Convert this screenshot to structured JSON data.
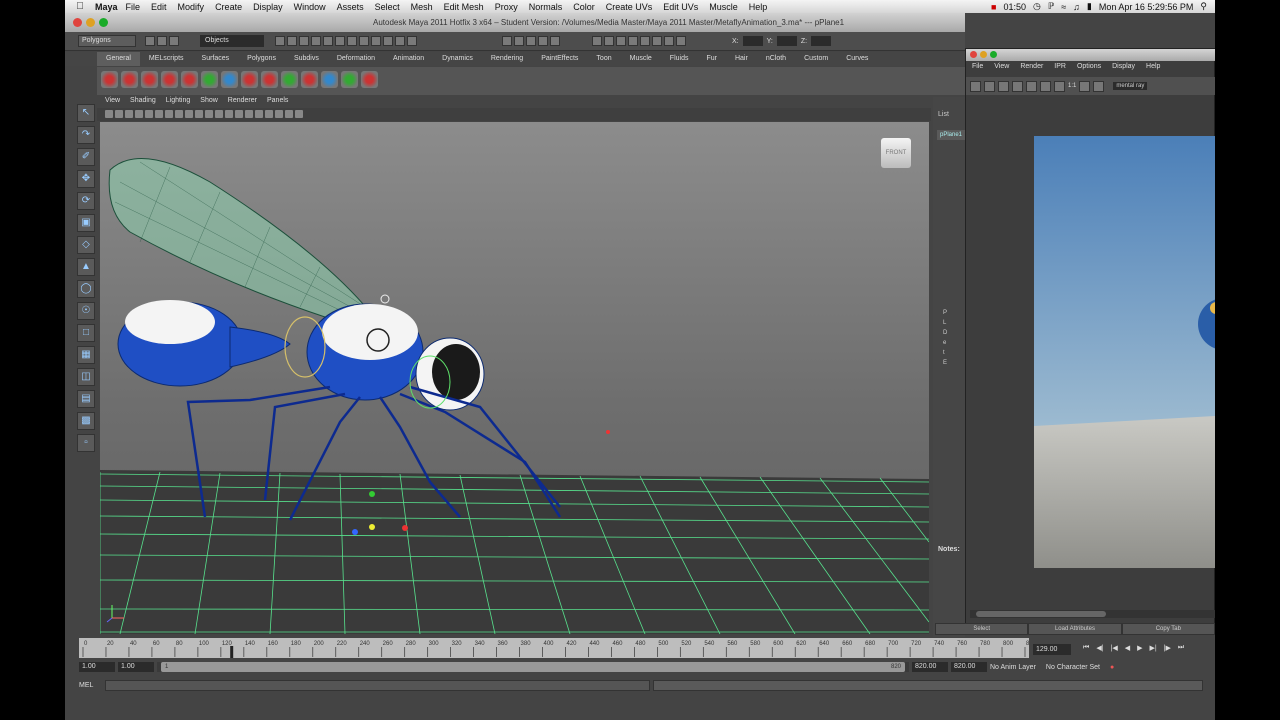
{
  "menubar": {
    "app_name": "Maya",
    "items": [
      "File",
      "Edit",
      "Modify",
      "Create",
      "Display",
      "Window",
      "Assets",
      "Select",
      "Mesh",
      "Edit Mesh",
      "Proxy",
      "Normals",
      "Color",
      "Create UVs",
      "Edit UVs",
      "Muscle",
      "Help"
    ],
    "clock": "01:50",
    "datetime": "Mon Apr 16  5:29:56 PM"
  },
  "window": {
    "title": "Autodesk Maya 2011 Hotfix 3 x64 – Student Version: /Volumes/Media Master/Maya 2011 Master/MetaflyAnimation_3.ma*  ---  pPlane1"
  },
  "status_line": {
    "mode": "Polygons",
    "selection_field": "Objects",
    "x_label": "X:",
    "y_label": "Y:",
    "z_label": "Z:"
  },
  "shelf": {
    "tabs": [
      "General",
      "MELscripts",
      "Surfaces",
      "Polygons",
      "Subdivs",
      "Deformation",
      "Animation",
      "Dynamics",
      "Rendering",
      "PaintEffects",
      "Toon",
      "Muscle",
      "Fluids",
      "Fur",
      "Hair",
      "nCloth",
      "Custom",
      "Curves"
    ],
    "active_tab": "General"
  },
  "panel": {
    "menus": [
      "View",
      "Shading",
      "Lighting",
      "Show",
      "Renderer",
      "Panels"
    ],
    "view_cube_label": "FRONT"
  },
  "channel_box": {
    "tab": "List",
    "selected_object": "pPlane1",
    "rows": [
      "P",
      "L",
      "D",
      "e",
      "t",
      "E"
    ],
    "notes_label": "Notes:"
  },
  "render_view": {
    "menus": [
      "File",
      "View",
      "Render",
      "IPR",
      "Options",
      "Display",
      "Help"
    ],
    "ratio_label": "1:1",
    "renderer": "mental ray"
  },
  "attribute_buttons": [
    "Select",
    "Load Attributes",
    "Copy Tab"
  ],
  "time_slider": {
    "ticks": [
      "0",
      "20",
      "40",
      "60",
      "80",
      "100",
      "120",
      "140",
      "160",
      "180",
      "200",
      "220",
      "240",
      "260",
      "280",
      "300",
      "320",
      "340",
      "360",
      "380",
      "400",
      "420",
      "440",
      "460",
      "480",
      "500",
      "520",
      "540",
      "560",
      "580",
      "600",
      "620",
      "640",
      "660",
      "680",
      "700",
      "720",
      "740",
      "760",
      "780",
      "800",
      "820"
    ],
    "current_frame": "129.00",
    "playhead_frame": 129
  },
  "range_slider": {
    "start_time": "1.00",
    "playback_start": "1.00",
    "slider_start": "1",
    "slider_end": "820",
    "playback_end": "820.00",
    "end_time": "820.00",
    "anim_layer": "No Anim Layer",
    "character_set": "No Character Set"
  },
  "command_line": {
    "label": "MEL"
  }
}
